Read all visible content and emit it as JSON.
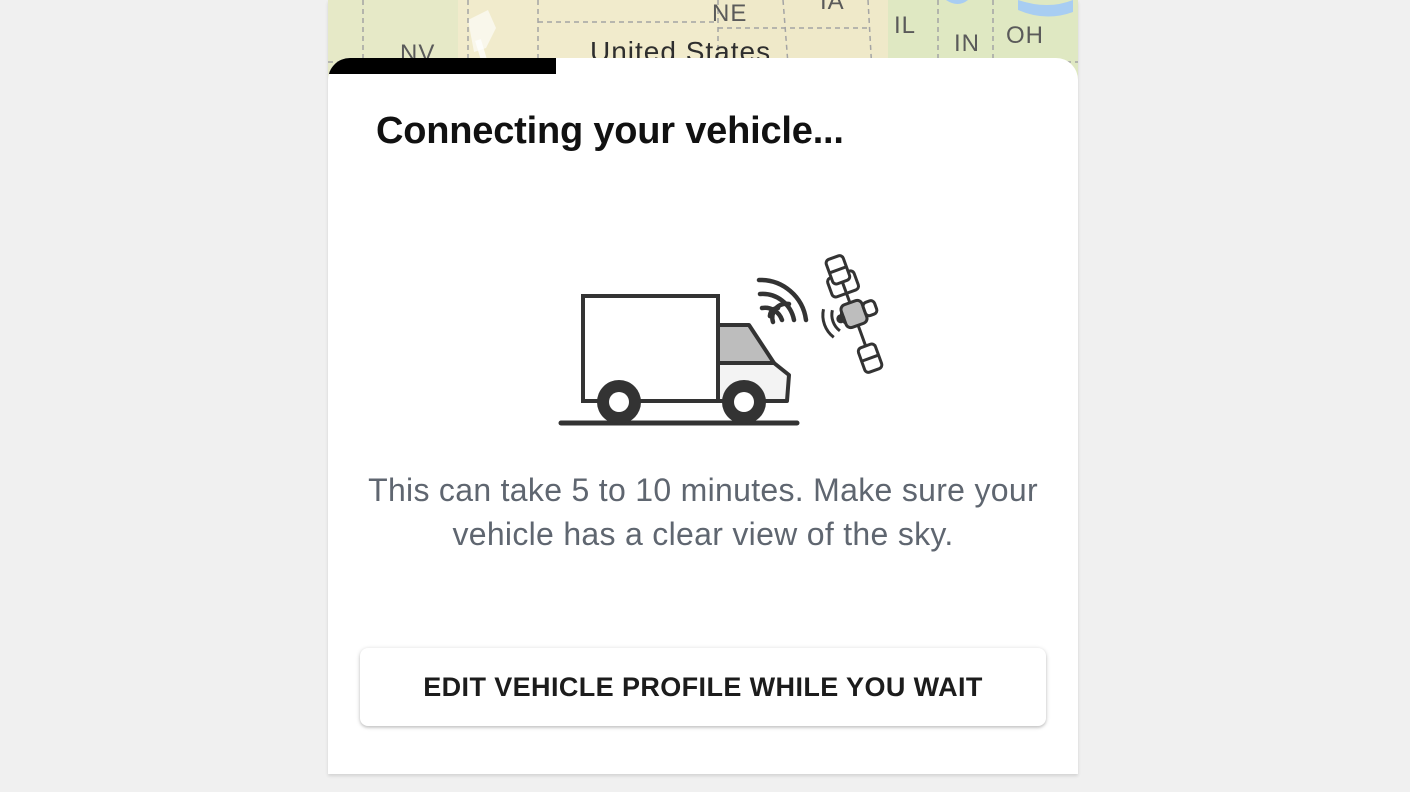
{
  "map": {
    "labels": {
      "nv": "NV",
      "ne": "NE",
      "ia": "IA",
      "il": "IL",
      "in": "IN",
      "oh": "OH",
      "country": "United States"
    }
  },
  "connection_sheet": {
    "progress_fraction": 0.304,
    "title": "Connecting your vehicle...",
    "illustration_icons": [
      "truck-icon",
      "signal-waves-icon",
      "satellite-icon"
    ],
    "description": "This can take 5 to 10 minutes. Make sure your vehicle has a clear view of the sky.",
    "edit_button_label": "EDIT VEHICLE PROFILE WHILE YOU WAIT"
  },
  "colors": {
    "progress": "#000000",
    "title": "#111111",
    "description": "#5f6670",
    "background": "#f0f0f0",
    "map_land": "#efe9c9",
    "map_water": "#a8cdf2"
  }
}
